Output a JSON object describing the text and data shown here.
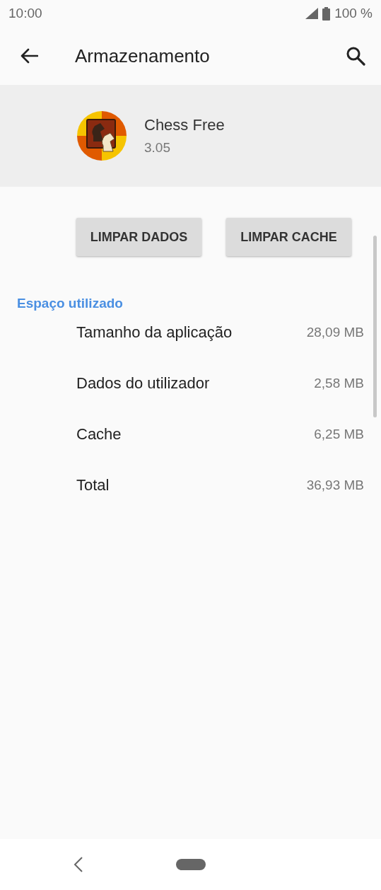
{
  "status_bar": {
    "time": "10:00",
    "battery": "100 %"
  },
  "app_bar": {
    "title": "Armazenamento"
  },
  "app": {
    "name": "Chess Free",
    "version": "3.05"
  },
  "buttons": [
    "LIMPAR DADOS",
    "LIMPAR CACHE"
  ],
  "section": {
    "title": "Espaço utilizado",
    "rows": [
      {
        "label": "Tamanho da aplicação",
        "value": "28,09 MB"
      },
      {
        "label": "Dados do utilizador",
        "value": "2,58 MB"
      },
      {
        "label": "Cache",
        "value": "6,25 MB"
      },
      {
        "label": "Total",
        "value": "36,93 MB"
      }
    ]
  }
}
